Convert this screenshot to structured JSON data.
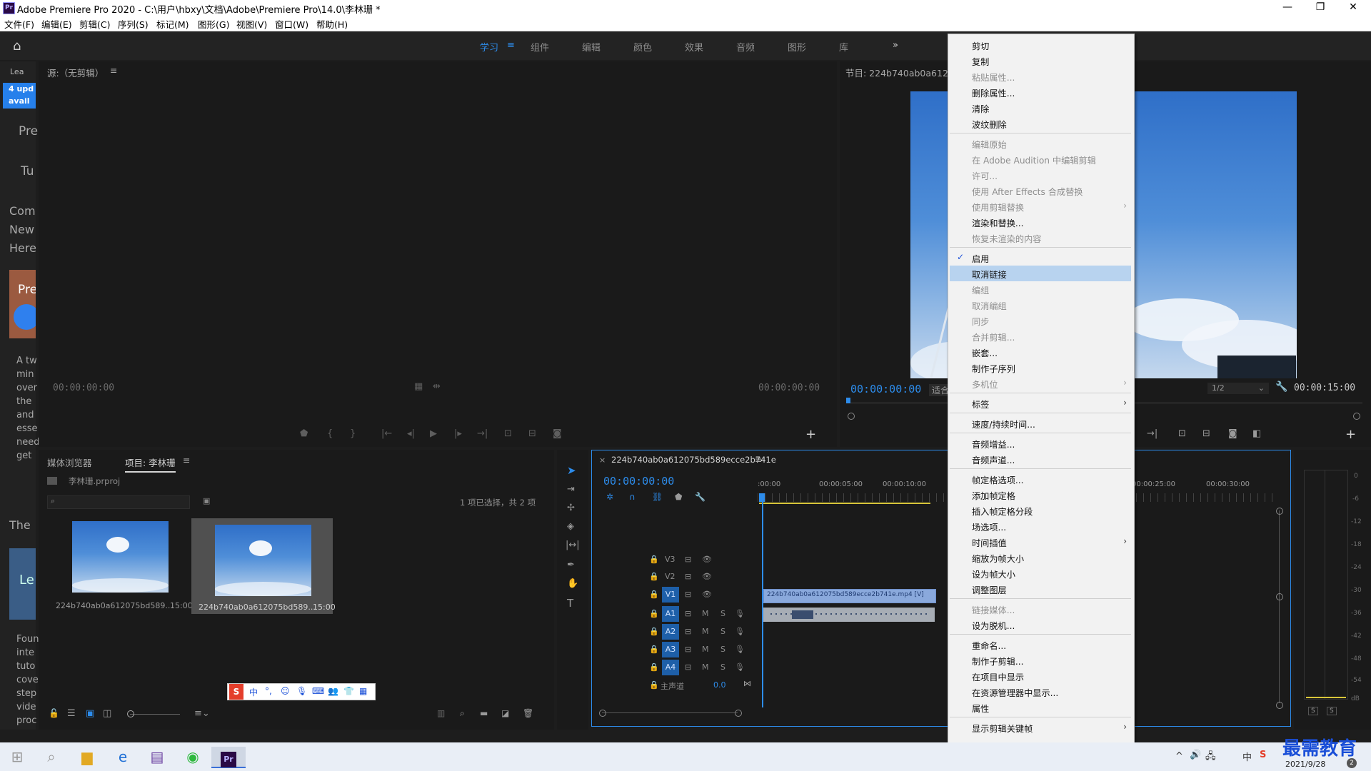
{
  "window": {
    "title": "Adobe Premiere Pro 2020 - C:\\用户\\hbxy\\文档\\Adobe\\Premiere Pro\\14.0\\李林珊 *",
    "app_icon_text": "Pr",
    "minimize": "—",
    "maximize": "❐",
    "close": "✕"
  },
  "menubar": [
    "文件(F)",
    "编辑(E)",
    "剪辑(C)",
    "序列(S)",
    "标记(M)",
    "图形(G)",
    "视图(V)",
    "窗口(W)",
    "帮助(H)"
  ],
  "workspaces": {
    "items": [
      "学习",
      "组件",
      "编辑",
      "颜色",
      "效果",
      "音频",
      "图形",
      "库"
    ],
    "active": "学习",
    "more": "»"
  },
  "learn_panel": {
    "tab": "Lea",
    "badge_line1": "4 upd",
    "badge_line2": "avail",
    "frag1": "Pre",
    "frag2": "Tu",
    "frag3": "Com",
    "frag4": "New",
    "frag5": "Here",
    "frag6": "Pre",
    "lines": [
      "A tw",
      "min",
      "over",
      "the",
      "and",
      "esse",
      "need",
      "get"
    ],
    "frag7": "The",
    "frag8": "Le",
    "lines2": [
      "Foun",
      "inte",
      "tuto",
      "cove",
      "step",
      "vide",
      "proc"
    ]
  },
  "source": {
    "title": "源:（无剪辑）",
    "tc_left": "00:00:00:00",
    "tc_right": "00:00:00:00"
  },
  "program": {
    "title": "节目: 224b740ab0a612075b",
    "tc_current": "00:00:00:00",
    "fit_fragment": "适合",
    "quality": "1/2",
    "tc_duration": "00:00:15:00"
  },
  "project": {
    "tabs": [
      "媒体浏览器",
      "项目: 李林珊"
    ],
    "file": "李林珊.prproj",
    "status": "1 项已选择，共 2 项",
    "items": [
      {
        "name": "224b740ab0a612075bd589...",
        "duration": "15:00"
      },
      {
        "name": "224b740ab0a612075bd589...",
        "duration": "15:00"
      }
    ]
  },
  "ime_toolbar": [
    "S",
    "中",
    "°,",
    "☺",
    "🎙",
    "⌨",
    "👥",
    "👕",
    "▦"
  ],
  "timeline": {
    "sequence_name": "224b740ab0a612075bd589ecce2b741e",
    "timecode": "00:00:00:00",
    "ruler": [
      ":00:00",
      "00:00:05:00",
      "00:00:10:00",
      "00:00:25:00",
      "00:00:30:00"
    ],
    "tracks": [
      {
        "label": "V3",
        "type": "video"
      },
      {
        "label": "V2",
        "type": "video"
      },
      {
        "label": "V1",
        "type": "video",
        "selected": true
      },
      {
        "label": "A1",
        "type": "audio",
        "selected": true
      },
      {
        "label": "A2",
        "type": "audio",
        "selected": true
      },
      {
        "label": "A3",
        "type": "audio",
        "selected": true
      },
      {
        "label": "A4",
        "type": "audio",
        "selected": true
      }
    ],
    "master": {
      "label": "主声道",
      "value": "0.0"
    },
    "clip_label": "224b740ab0a612075bd589ecce2b741e.mp4 [V]",
    "track_buttons": {
      "mute": "M",
      "solo": "S"
    }
  },
  "audio_meter": {
    "scale": [
      "0",
      "-6",
      "-12",
      "-18",
      "-24",
      "-30",
      "-36",
      "-42",
      "-48",
      "-54",
      "dB"
    ],
    "solo": [
      "S",
      "S"
    ]
  },
  "context_menu": {
    "highlighted": "取消链接",
    "checked": "启用",
    "groups": [
      [
        {
          "label": "剪切",
          "enabled": true
        },
        {
          "label": "复制",
          "enabled": true
        },
        {
          "label": "粘贴属性...",
          "enabled": false
        },
        {
          "label": "删除属性...",
          "enabled": true
        },
        {
          "label": "清除",
          "enabled": true
        },
        {
          "label": "波纹删除",
          "enabled": true
        }
      ],
      [
        {
          "label": "编辑原始",
          "enabled": false
        },
        {
          "label": "在 Adobe Audition 中编辑剪辑",
          "enabled": false
        },
        {
          "label": "许可...",
          "enabled": false
        },
        {
          "label": "使用 After Effects 合成替换",
          "enabled": false
        },
        {
          "label": "使用剪辑替换",
          "enabled": false,
          "submenu": true
        },
        {
          "label": "渲染和替换...",
          "enabled": true
        },
        {
          "label": "恢复未渲染的内容",
          "enabled": false
        }
      ],
      [
        {
          "label": "启用",
          "enabled": true
        },
        {
          "label": "取消链接",
          "enabled": true
        },
        {
          "label": "编组",
          "enabled": false
        },
        {
          "label": "取消编组",
          "enabled": false
        },
        {
          "label": "同步",
          "enabled": false
        },
        {
          "label": "合并剪辑...",
          "enabled": false
        },
        {
          "label": "嵌套...",
          "enabled": true
        },
        {
          "label": "制作子序列",
          "enabled": true
        },
        {
          "label": "多机位",
          "enabled": false,
          "submenu": true
        }
      ],
      [
        {
          "label": "标签",
          "enabled": true,
          "submenu": true
        }
      ],
      [
        {
          "label": "速度/持续时间...",
          "enabled": true
        }
      ],
      [
        {
          "label": "音频增益...",
          "enabled": true
        },
        {
          "label": "音频声道...",
          "enabled": true
        }
      ],
      [
        {
          "label": "帧定格选项...",
          "enabled": true
        },
        {
          "label": "添加帧定格",
          "enabled": true
        },
        {
          "label": "插入帧定格分段",
          "enabled": true
        },
        {
          "label": "场选项...",
          "enabled": true
        },
        {
          "label": "时间插值",
          "enabled": true,
          "submenu": true
        },
        {
          "label": "缩放为帧大小",
          "enabled": true
        },
        {
          "label": "设为帧大小",
          "enabled": true
        },
        {
          "label": "调整图层",
          "enabled": true
        }
      ],
      [
        {
          "label": "链接媒体...",
          "enabled": false
        },
        {
          "label": "设为脱机...",
          "enabled": true
        }
      ],
      [
        {
          "label": "重命名...",
          "enabled": true
        },
        {
          "label": "制作子剪辑...",
          "enabled": true
        },
        {
          "label": "在项目中显示",
          "enabled": true
        },
        {
          "label": "在资源管理器中显示...",
          "enabled": true
        },
        {
          "label": "属性",
          "enabled": true
        }
      ],
      [
        {
          "label": "显示剪辑关键帧",
          "enabled": true,
          "submenu": true
        }
      ]
    ]
  },
  "taskbar": {
    "apps": [
      "windows-start",
      "search",
      "file-explorer",
      "edge",
      "winrar",
      "wechat",
      "premiere"
    ],
    "premiere_label": "Pr",
    "watermark": "最需教育",
    "date": "2021/9/28",
    "notify_count": "2",
    "tray": [
      "^",
      "🔊",
      "🖧",
      "中",
      "S"
    ]
  }
}
